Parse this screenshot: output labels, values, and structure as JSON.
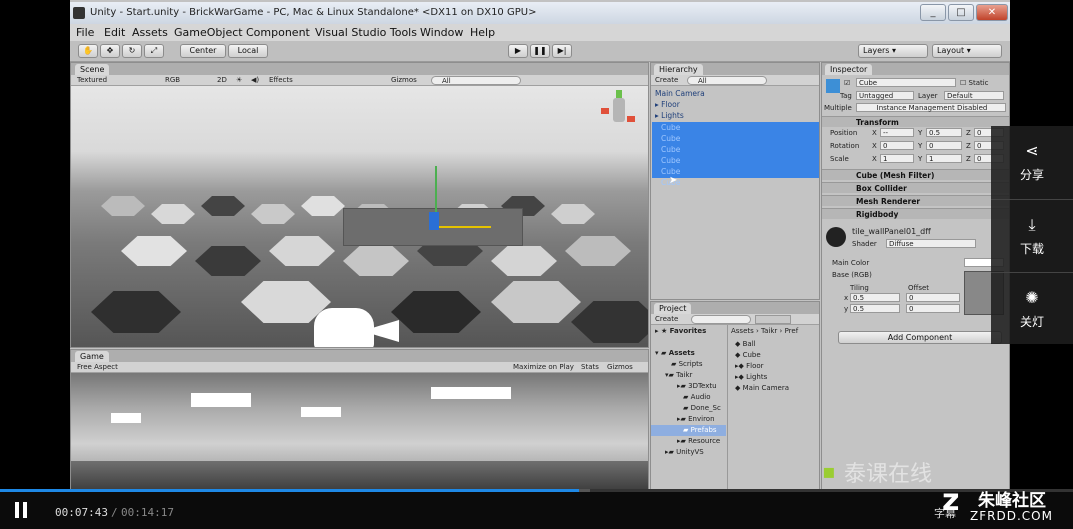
{
  "window": {
    "title": "Unity - Start.unity - BrickWarGame - PC, Mac & Linux Standalone* <DX11 on DX10 GPU>",
    "controls": [
      "_",
      "□",
      "✕"
    ]
  },
  "menu": [
    "File",
    "Edit",
    "Assets",
    "GameObject",
    "Component",
    "Visual Studio Tools",
    "Window",
    "Help"
  ],
  "toolbar": {
    "pivot": "Center",
    "space": "Local",
    "layers": "Layers",
    "layout": "Layout"
  },
  "scene": {
    "tab": "Scene",
    "shading": "Textured",
    "render": "RGB",
    "mode2d": "2D",
    "effects": "Effects",
    "gizmos": "Gizmos",
    "search": "All"
  },
  "game": {
    "tab": "Game",
    "aspect": "Free Aspect",
    "maximize": "Maximize on Play",
    "stats": "Stats",
    "gizmos": "Gizmos"
  },
  "hierarchy": {
    "tab": "Hierarchy",
    "create": "Create",
    "search": "All",
    "items": [
      "Main Camera",
      "Floor",
      "Lights"
    ],
    "selected": [
      "Cube",
      "Cube",
      "Cube",
      "Cube",
      "Cube"
    ],
    "last": "Cube"
  },
  "project": {
    "tab": "Project",
    "create": "Create",
    "favorites": "Favorites",
    "assets": "Assets",
    "tree": [
      "Scripts",
      "Taikr",
      "3DTextu",
      "Audio",
      "Done_Sc",
      "Environ",
      "Prefabs",
      "Resource",
      "UnityVS"
    ],
    "breadcrumb": "Assets › Taikr › Pref",
    "files": [
      "Ball",
      "Cube",
      "Floor",
      "Lights",
      "Main Camera"
    ]
  },
  "inspector": {
    "tab": "Inspector",
    "name": "Cube",
    "static": "Static",
    "tag_label": "Tag",
    "tag": "Untagged",
    "layer_label": "Layer",
    "layer": "Default",
    "multiple_label": "Multiple",
    "multiple_note": "Instance Management Disabled",
    "transform": "Transform",
    "position_label": "Position",
    "rotation_label": "Rotation",
    "scale_label": "Scale",
    "position": {
      "x": "--",
      "y": "0.5",
      "z": "0"
    },
    "rotation": {
      "x": "0",
      "y": "0",
      "z": "0"
    },
    "scale": {
      "x": "1",
      "y": "1",
      "z": "0"
    },
    "components": [
      "Cube (Mesh Filter)",
      "Box Collider",
      "Mesh Renderer",
      "Rigidbody"
    ],
    "material": "tile_wallPanel01_dff",
    "shader_label": "Shader",
    "shader": "Diffuse",
    "main_color": "Main Color",
    "base": "Base (RGB)",
    "tiling": "Tiling",
    "offset": "Offset",
    "tiling_x": "0.5",
    "tiling_y": "0.5",
    "offset_x": "0",
    "offset_y": "0",
    "add_component": "Add Component"
  },
  "watermark": "泰课在线",
  "side": [
    {
      "icon": "share-icon",
      "label": "分享"
    },
    {
      "icon": "download-icon",
      "label": "下载"
    },
    {
      "icon": "lights-off-icon",
      "label": "关灯"
    }
  ],
  "player": {
    "current": "00:07:43",
    "separator": " / ",
    "total": "00:14:17",
    "progress": 0.54,
    "buffered": 0.55,
    "subtitle": "字幕",
    "logo": "朱峰社区",
    "logo_url": "ZFRDD.COM"
  }
}
